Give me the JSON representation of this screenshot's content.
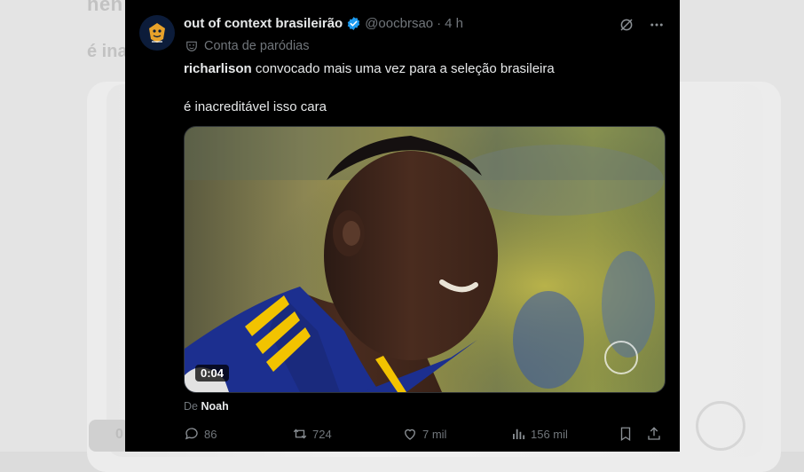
{
  "background": {
    "top_text": "nen",
    "mid_text": "é ina",
    "badge_text": "0"
  },
  "tweet": {
    "display_name": "out of context brasileirão",
    "handle": "@oocbrsao",
    "separator": "·",
    "time": "4 h",
    "parody_label": "Conta de paródias",
    "mention": "richarlison",
    "line1_rest": " convocado mais uma vez para a seleção brasileira",
    "line2": "é inacreditável isso cara",
    "video_duration": "0:04",
    "source_prefix": "De",
    "source_name": "Noah"
  },
  "actions": {
    "replies": "86",
    "reposts": "724",
    "likes": "7 mil",
    "views": "156 mil"
  },
  "icons": {
    "verified": "verified-badge-icon",
    "grok": "grok-icon",
    "more": "more-icon",
    "parody": "parody-mask-icon",
    "reply": "reply-icon",
    "repost": "repost-icon",
    "like": "like-icon",
    "views": "views-icon",
    "bookmark": "bookmark-icon",
    "share": "share-icon"
  },
  "colors": {
    "card_bg": "#000000",
    "text": "#e7e9ea",
    "muted": "#71767b",
    "verified": "#1d9bf0",
    "jersey": "#1c2f8f",
    "jersey_stripe": "#f2c300"
  }
}
